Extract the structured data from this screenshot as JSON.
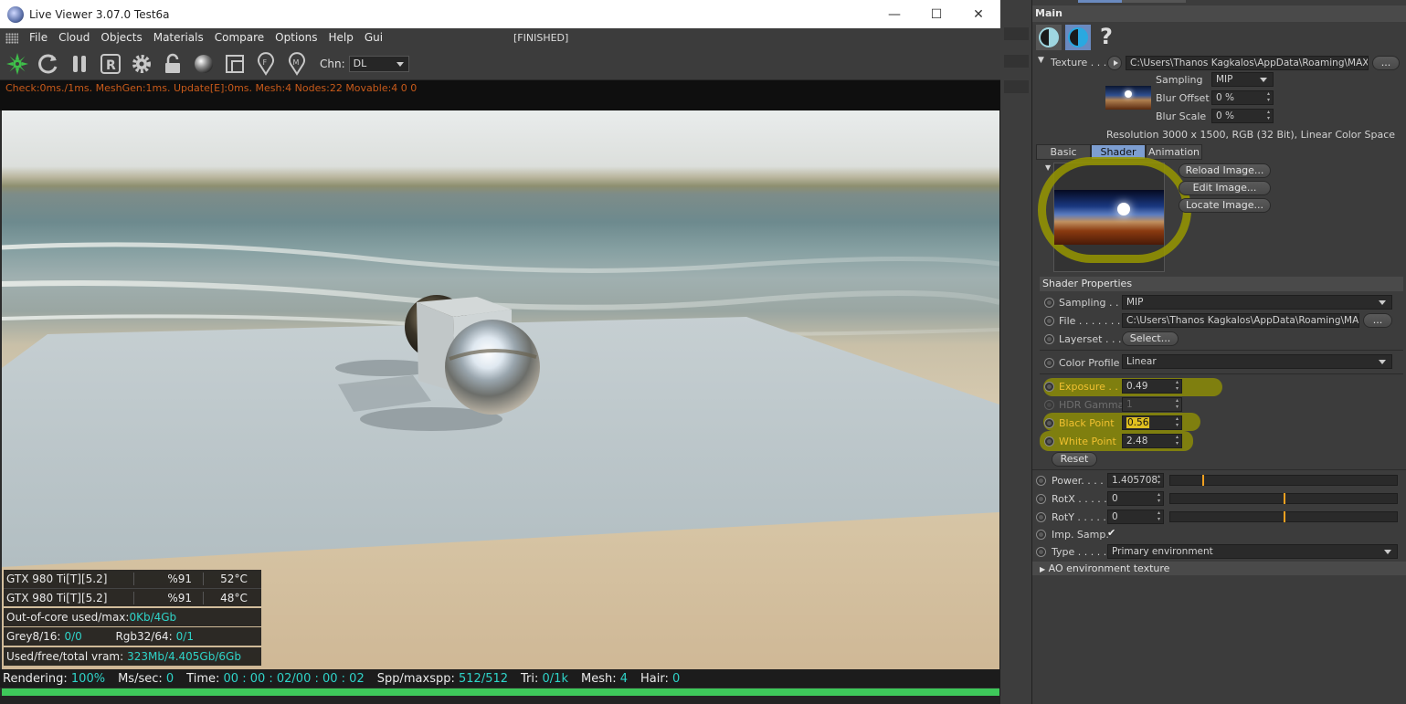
{
  "window": {
    "title": "Live Viewer 3.07.0 Test6a",
    "minimize_glyph": "—",
    "maximize_glyph": "☐",
    "close_glyph": "✕"
  },
  "menu": {
    "items": [
      "File",
      "Cloud",
      "Objects",
      "Materials",
      "Compare",
      "Options",
      "Help",
      "Gui"
    ],
    "status": "[FINISHED]"
  },
  "toolbar": {
    "icons": [
      "gear-star-icon",
      "reload-icon",
      "pause-icon",
      "r-icon",
      "settings-gear-icon",
      "lock-icon",
      "sphere-icon",
      "region-icon",
      "pin-f-icon",
      "pin-m-icon"
    ],
    "channel_label": "Chn:",
    "channel_value": "DL"
  },
  "status_line": "Check:0ms./1ms. MeshGen:1ms. Update[E]:0ms. Mesh:4 Nodes:22 Movable:4  0 0",
  "hud": {
    "gpus": [
      {
        "name": "GTX 980 Ti[T][5.2]",
        "usage": "%91",
        "temp": "52°C"
      },
      {
        "name": "GTX 980 Ti[T][5.2]",
        "usage": "%91",
        "temp": "48°C"
      }
    ],
    "out_of_core_label": "Out-of-core used/max:",
    "out_of_core_value": "0Kb/4Gb",
    "grey_label": "Grey8/16:",
    "grey_value": "0/0",
    "rgb_label": "Rgb32/64:",
    "rgb_value": "0/1",
    "vram_label": "Used/free/total vram:",
    "vram_value": "323Mb/4.405Gb/6Gb"
  },
  "bottom": {
    "rendering_label": "Rendering:",
    "rendering_value": "100%",
    "ms_label": "Ms/sec:",
    "ms_value": "0",
    "time_label": "Time:",
    "time_value": "00 : 00 : 02/00 : 00 : 02",
    "spp_label": "Spp/maxspp:",
    "spp_value": "512/512",
    "tri_label": "Tri:",
    "tri_value": "0/1k",
    "mesh_label": "Mesh:",
    "mesh_value": "4",
    "hair_label": "Hair:",
    "hair_value": "0",
    "progress": 1.0
  },
  "panel": {
    "main_title": "Main",
    "help_glyph": "?",
    "texture_label": "Texture . . .",
    "texture_path": "C:\\Users\\Thanos Kagkalos\\AppData\\Roaming\\MAX",
    "ellipsis": "...",
    "sampling_label": "Sampling",
    "sampling_value": "MIP",
    "blur_offset_label": "Blur Offset",
    "blur_offset_value": "0 %",
    "blur_scale_label": "Blur Scale",
    "blur_scale_value": "0 %",
    "resolution": "Resolution 3000 x 1500, RGB (32 Bit), Linear Color Space",
    "tabs": [
      "Basic",
      "Shader",
      "Animation"
    ],
    "active_tab": "Shader",
    "reload_btn": "Reload Image...",
    "edit_btn": "Edit Image...",
    "locate_btn": "Locate Image...",
    "shader_props_title": "Shader Properties",
    "sp_sampling_label": "Sampling . .",
    "sp_sampling_value": "MIP",
    "file_label": "File . . . . . . .",
    "file_value": "C:\\Users\\Thanos Kagkalos\\AppData\\Roaming\\MA",
    "layerset_label": "Layerset . . .",
    "layerset_btn": "Select...",
    "color_profile_label": "Color Profile",
    "color_profile_value": "Linear",
    "exposure_label": "Exposure . .",
    "exposure_value": "0.49",
    "hdr_gamma_label": "HDR Gamma",
    "hdr_gamma_value": "1",
    "black_point_label": "Black Point",
    "black_point_value": "0.56",
    "white_point_label": "White Point",
    "white_point_value": "2.48",
    "reset_btn": "Reset",
    "power_label": "Power. . . . .",
    "power_value": "1.405708",
    "power_slider": 0.14,
    "rotx_label": "RotX . . . . . .",
    "rotx_value": "0",
    "rotx_slider": 0.5,
    "roty_label": "RotY . . . . . .",
    "roty_value": "0",
    "roty_slider": 0.5,
    "imp_samp_label": "Imp. Samp.",
    "imp_samp_check": "✔",
    "type_label": "Type . . . . . .",
    "type_value": "Primary environment",
    "ao_label": "AO environment texture"
  },
  "colors": {
    "accent_tab": "#7d9ed1",
    "highlight": "#969600",
    "status_text": "#c85a1a",
    "hud_value": "#2fd3c8",
    "progress": "#3ec85a"
  }
}
